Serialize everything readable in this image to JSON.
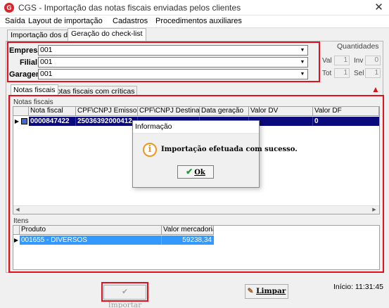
{
  "window": {
    "title": "CGS - Importação das notas fiscais enviadas pelos clientes",
    "app_icon_letter": "G",
    "close_glyph": "✕"
  },
  "menu": [
    "Saída",
    "Layout de importação",
    "Cadastros",
    "Procedimentos auxiliares"
  ],
  "tabs": [
    "Importação dos dados",
    "Geração do check-list"
  ],
  "form": {
    "empresa_label": "Empresa",
    "empresa_value": "001",
    "filial_label": "Filial",
    "filial_value": "001",
    "garagem_label": "Garagem",
    "garagem_value": "001"
  },
  "quantidades": {
    "title": "Quantidades",
    "val_label": "Val",
    "val_value": "1",
    "inv_label": "Inv",
    "inv_value": "0",
    "tot_label": "Tot",
    "tot_value": "1",
    "sel_label": "Sel",
    "sel_value": "1"
  },
  "inner_tabs": [
    "Notas fiscais",
    "Notas fiscais com críticas"
  ],
  "notas_group": {
    "caption": "Notas fiscais",
    "columns": [
      "Nota fiscal",
      "CPF\\CNPJ Emissor",
      "CPF\\CNPJ Destinatário",
      "Data geração",
      "Valor DV",
      "Valor DF"
    ],
    "row": {
      "nota": "0000847422",
      "emissor": "25036392000412",
      "destinatario": "",
      "data": "",
      "valor_dv": "",
      "valor_df": "0"
    }
  },
  "itens_group": {
    "caption": "Itens",
    "columns": [
      "Produto",
      "Valor mercadoria"
    ],
    "row": {
      "produto": "001655 - DIVERSOS",
      "valor": "59238,34"
    }
  },
  "dialog": {
    "title": "Informação",
    "message": "Importação efetuada com sucesso.",
    "ok_label": "Ok",
    "icon": "info-icon"
  },
  "buttons": {
    "importar": "Importar",
    "limpar": "Limpar"
  },
  "status": {
    "inicio": "Início: 11:31:45"
  },
  "colors": {
    "highlight_red": "#e3101e",
    "selected_row": "#0a0a7c",
    "itens_selected": "#3399ff"
  }
}
